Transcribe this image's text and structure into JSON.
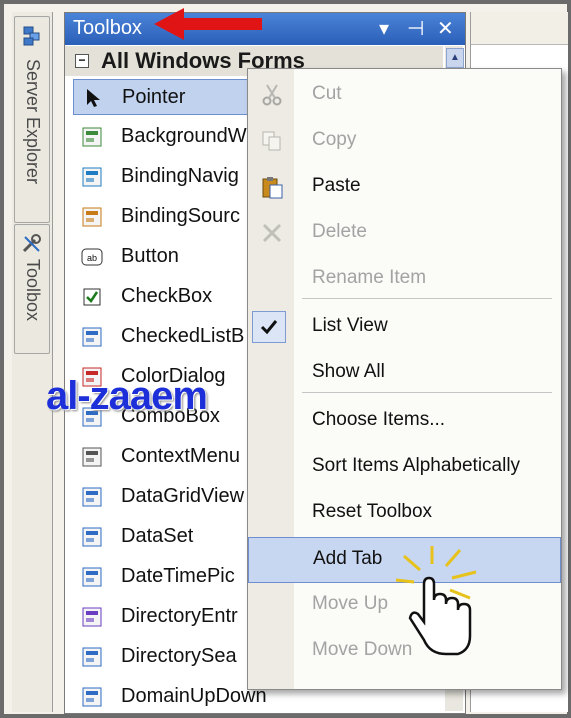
{
  "side_tabs": [
    {
      "label": "Server Explorer",
      "icon": "server-explorer-icon"
    },
    {
      "label": "Toolbox",
      "icon": "toolbox-icon"
    }
  ],
  "toolbox": {
    "title": "Toolbox",
    "title_controls": [
      "▾",
      "⊣",
      "✕"
    ],
    "group_header": "All Windows Forms",
    "group_toggle": "−",
    "items": [
      {
        "label": "Pointer",
        "icon": "pointer-icon",
        "selected": true
      },
      {
        "label": "BackgroundW",
        "icon": "background-worker-icon"
      },
      {
        "label": "BindingNavig",
        "icon": "binding-navigator-icon"
      },
      {
        "label": "BindingSourc",
        "icon": "binding-source-icon"
      },
      {
        "label": "Button",
        "icon": "button-icon"
      },
      {
        "label": "CheckBox",
        "icon": "checkbox-icon"
      },
      {
        "label": "CheckedListB",
        "icon": "checked-listbox-icon"
      },
      {
        "label": "ColorDialog",
        "icon": "color-dialog-icon"
      },
      {
        "label": "ComboBox",
        "icon": "combobox-icon"
      },
      {
        "label": "ContextMenu",
        "icon": "context-menu-icon"
      },
      {
        "label": "DataGridView",
        "icon": "datagridview-icon"
      },
      {
        "label": "DataSet",
        "icon": "dataset-icon"
      },
      {
        "label": "DateTimePic",
        "icon": "datetimepicker-icon"
      },
      {
        "label": "DirectoryEntr",
        "icon": "directory-entry-icon"
      },
      {
        "label": "DirectorySea",
        "icon": "directory-searcher-icon"
      },
      {
        "label": "DomainUpDown",
        "icon": "domain-updown-icon"
      }
    ]
  },
  "context_menu": {
    "items": [
      {
        "label": "Cut",
        "icon": "cut-icon",
        "disabled": true
      },
      {
        "label": "Copy",
        "icon": "copy-icon",
        "disabled": true
      },
      {
        "label": "Paste",
        "icon": "paste-icon",
        "disabled": false
      },
      {
        "label": "Delete",
        "icon": "delete-icon",
        "disabled": true
      },
      {
        "label": "Rename Item",
        "icon": "",
        "disabled": true
      },
      {
        "label": "List View",
        "icon": "check-icon",
        "disabled": false,
        "checked": true
      },
      {
        "label": "Show All",
        "icon": "",
        "disabled": false
      },
      {
        "label": "Choose Items...",
        "icon": "",
        "disabled": false
      },
      {
        "label": "Sort Items Alphabetically",
        "icon": "",
        "disabled": false
      },
      {
        "label": "Reset Toolbox",
        "icon": "",
        "disabled": false
      },
      {
        "label": "Add Tab",
        "icon": "",
        "disabled": false,
        "highlighted": true
      },
      {
        "label": "Move Up",
        "icon": "",
        "disabled": true
      },
      {
        "label": "Move Down",
        "icon": "",
        "disabled": true
      }
    ]
  },
  "overlays": {
    "watermark": "al-zaaem",
    "arrow_icon": "red-arrow-icon",
    "cursor_icon": "hand-cursor-icon"
  },
  "colors": {
    "title_bar": "#2b5fb8",
    "selection": "#c1d2ee",
    "menu_highlight": "#c8d7f1",
    "watermark": "#1d2fd8",
    "arrow": "#e01414"
  }
}
